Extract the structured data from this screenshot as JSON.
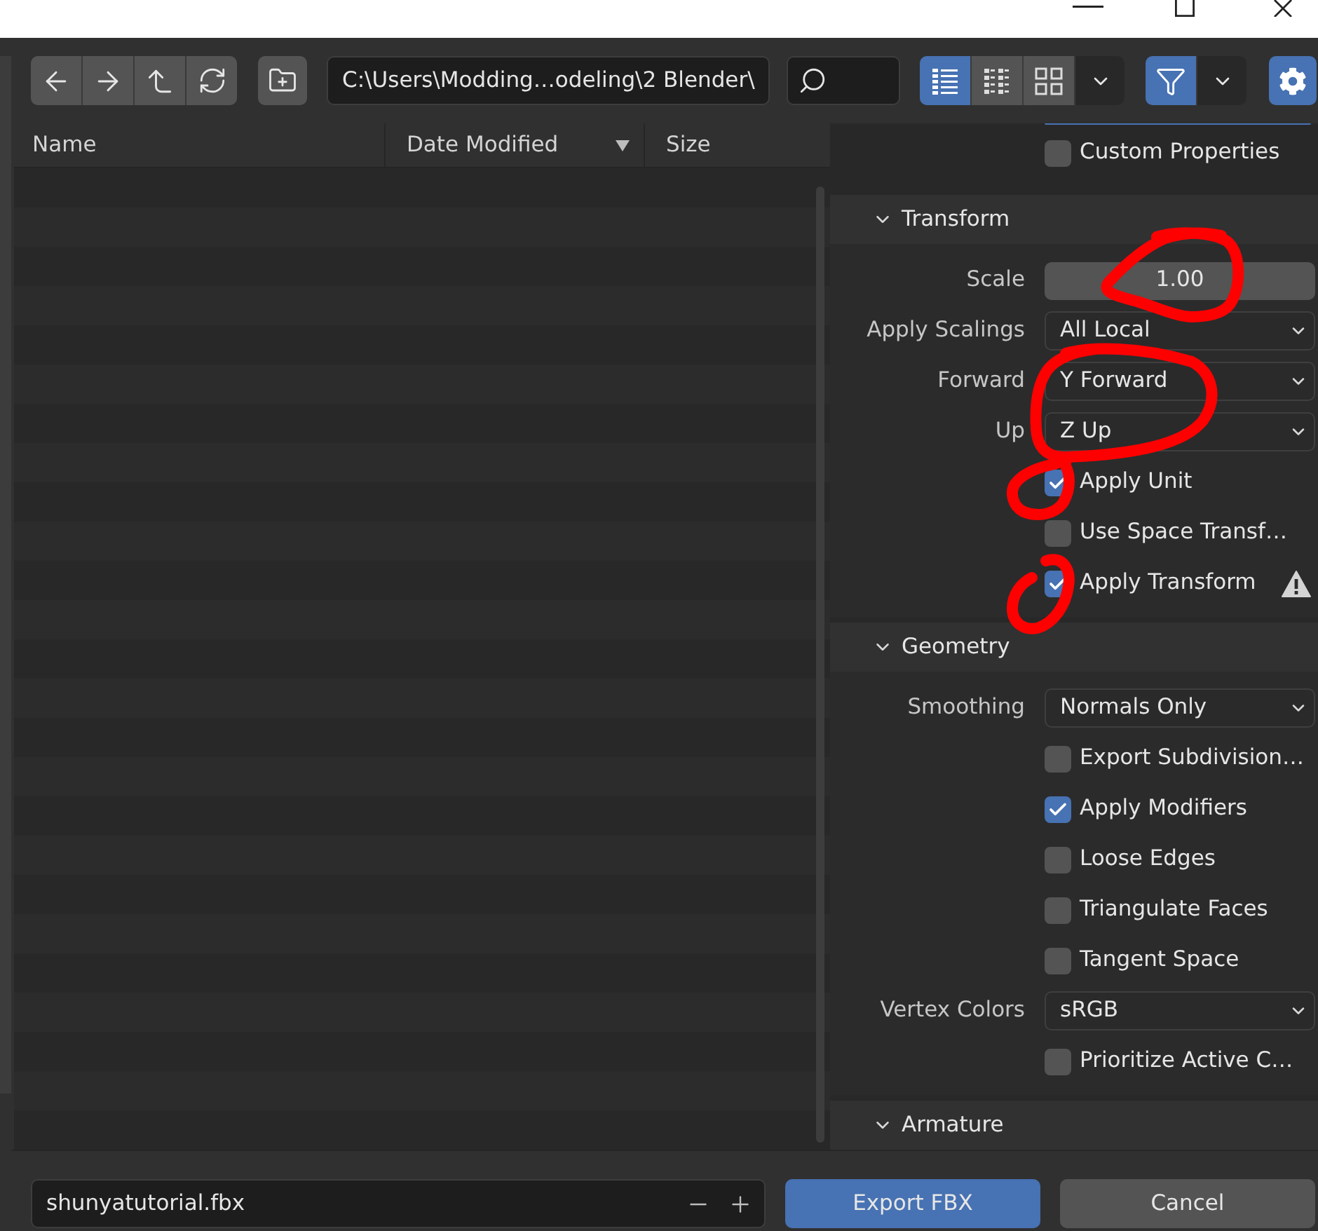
{
  "toolbar": {
    "path": "C:\\Users\\Modding…odeling\\2 Blender\\",
    "view_modes": [
      {
        "kind": "list",
        "selected": true
      },
      {
        "kind": "columns",
        "selected": false
      },
      {
        "kind": "grid",
        "selected": false
      }
    ],
    "filter_on": true,
    "sidebar_on": true
  },
  "file_list": {
    "columns": [
      {
        "label": "Name",
        "sorted": false
      },
      {
        "label": "Date Modified",
        "sorted": true
      },
      {
        "label": "Size",
        "sorted": false
      }
    ]
  },
  "settings": {
    "items": [
      {
        "kind": "checkbox",
        "label": "Custom Properties",
        "checked": false
      }
    ],
    "sections": [
      {
        "title": "Transform",
        "expanded": true,
        "rows": [
          {
            "kind": "number",
            "label": "Scale",
            "value": "1.00"
          },
          {
            "kind": "dropdown",
            "label": "Apply Scalings",
            "value": "All Local"
          },
          {
            "kind": "dropdown",
            "label": "Forward",
            "value": "Y Forward"
          },
          {
            "kind": "dropdown",
            "label": "Up",
            "value": "Z Up"
          },
          {
            "kind": "checkbox",
            "label": "Apply Unit",
            "checked": true
          },
          {
            "kind": "checkbox",
            "label": "Use Space Transf…",
            "checked": false
          },
          {
            "kind": "checkbox",
            "label": "Apply Transform",
            "checked": true,
            "warning": true
          }
        ]
      },
      {
        "title": "Geometry",
        "expanded": true,
        "rows": [
          {
            "kind": "dropdown",
            "label": "Smoothing",
            "value": "Normals Only"
          },
          {
            "kind": "checkbox",
            "label": "Export Subdivision…",
            "checked": false
          },
          {
            "kind": "checkbox",
            "label": "Apply Modifiers",
            "checked": true
          },
          {
            "kind": "checkbox",
            "label": "Loose Edges",
            "checked": false
          },
          {
            "kind": "checkbox",
            "label": "Triangulate Faces",
            "checked": false
          },
          {
            "kind": "checkbox",
            "label": "Tangent Space",
            "checked": false
          },
          {
            "kind": "dropdown",
            "label": "Vertex Colors",
            "value": "sRGB"
          },
          {
            "kind": "checkbox",
            "label": "Prioritize Active C…",
            "checked": false
          }
        ]
      },
      {
        "title": "Armature",
        "expanded": true
      }
    ]
  },
  "footer": {
    "filename": "shunyatutorial.fbx",
    "buttons": [
      {
        "kind": "primary",
        "label": "Export FBX"
      },
      {
        "kind": "secondary",
        "label": "Cancel"
      }
    ]
  }
}
